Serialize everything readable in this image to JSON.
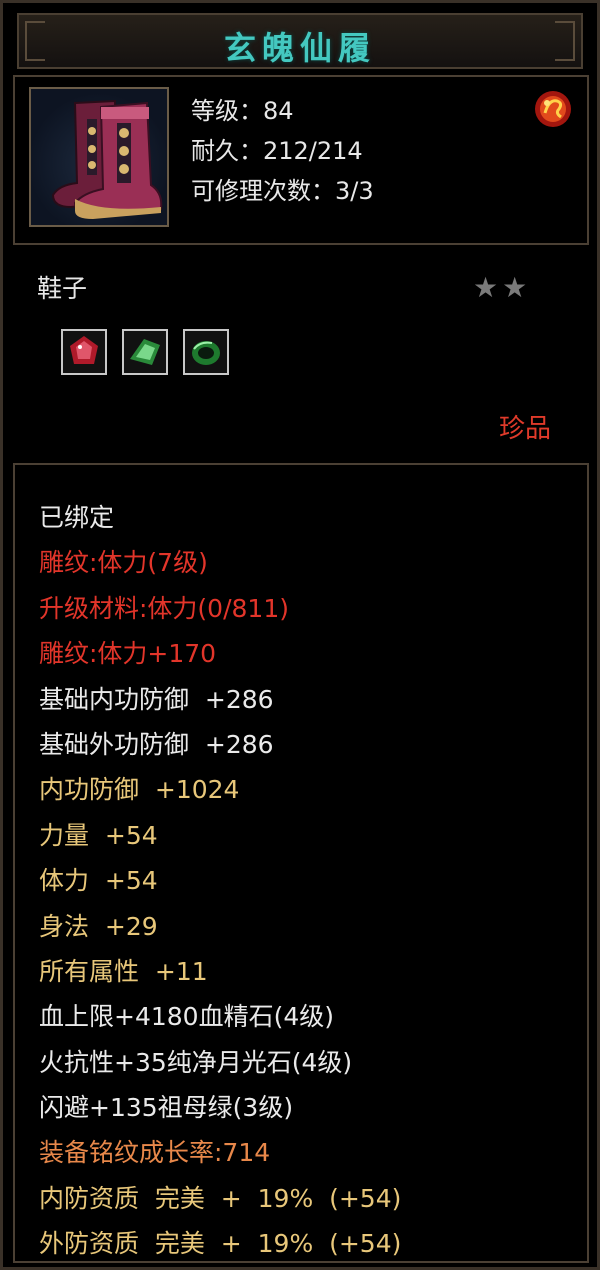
{
  "title": "玄魄仙履",
  "item": {
    "icon": "boots-icon",
    "level_line": "等级：84",
    "durability_line": "耐久：212/214",
    "repairs_line": "可修理次数：3/3",
    "sigil_icon": "fire-sigil-icon"
  },
  "type_label": "鞋子",
  "stars": 2,
  "gems": [
    "red-gem-icon",
    "green-gem-icon",
    "green-ring-gem-icon"
  ],
  "rarity": "珍品",
  "colors": {
    "title": "#44c8c0",
    "white": "#eaeaea",
    "red": "#e2352a",
    "gold": "#e8c77a",
    "orange": "#e8884a"
  },
  "stats": [
    {
      "text": "已绑定",
      "color": "white"
    },
    {
      "text": "雕纹:体力(7级)",
      "color": "red"
    },
    {
      "text": "升级材料:体力(0/811)",
      "color": "red"
    },
    {
      "text": "雕纹:体力+170",
      "color": "red"
    },
    {
      "text": "基础内功防御  +286",
      "color": "white"
    },
    {
      "text": "基础外功防御  +286",
      "color": "white"
    },
    {
      "text": "内功防御  +1024",
      "color": "gold"
    },
    {
      "text": "力量  +54",
      "color": "gold"
    },
    {
      "text": "体力  +54",
      "color": "gold"
    },
    {
      "text": "身法  +29",
      "color": "gold"
    },
    {
      "text": "所有属性  +11",
      "color": "gold"
    },
    {
      "text": "血上限+4180血精石(4级)",
      "color": "white"
    },
    {
      "text": "火抗性+35纯净月光石(4级)",
      "color": "white"
    },
    {
      "text": "闪避+135祖母绿(3级)",
      "color": "white"
    },
    {
      "text": "装备铭纹成长率:714",
      "color": "orange"
    },
    {
      "text": "内防资质  完美  +  19%  (+54)",
      "color": "gold"
    },
    {
      "text": "外防资质  完美  +  19%  (+54)",
      "color": "gold"
    }
  ]
}
